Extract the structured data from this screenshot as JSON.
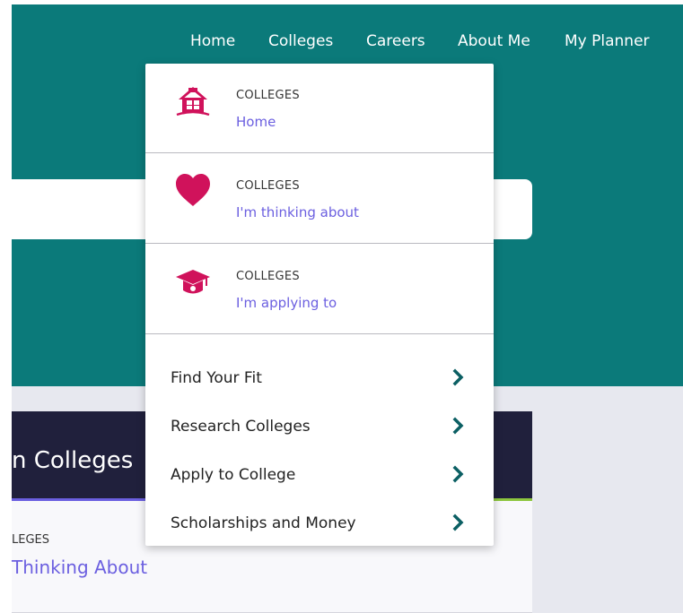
{
  "nav": {
    "items": [
      {
        "label": "Home"
      },
      {
        "label": "Colleges"
      },
      {
        "label": "Careers"
      },
      {
        "label": "About Me"
      },
      {
        "label": "My Planner"
      }
    ]
  },
  "background_card": {
    "title": "n Colleges",
    "eyebrow": "LEGES",
    "link": "Thinking About"
  },
  "dropdown": {
    "items": [
      {
        "eyebrow": "COLLEGES",
        "label": "Home",
        "icon": "house-icon"
      },
      {
        "eyebrow": "COLLEGES",
        "label": "I'm thinking about",
        "icon": "heart-icon"
      },
      {
        "eyebrow": "COLLEGES",
        "label": "I'm applying to",
        "icon": "graduation-cap-icon"
      }
    ],
    "links": [
      {
        "label": "Find Your Fit"
      },
      {
        "label": "Research Colleges"
      },
      {
        "label": "Apply to College"
      },
      {
        "label": "Scholarships and Money"
      }
    ]
  },
  "colors": {
    "header": "#0b7a7a",
    "icon_accent": "#d0125b",
    "link_accent": "#6b5fe0",
    "chevron": "#0b5f63",
    "card_dark": "#20203c"
  }
}
